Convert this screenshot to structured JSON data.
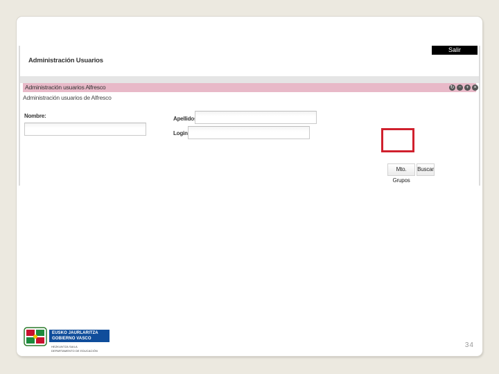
{
  "app": {
    "title": "Administración Usuarios",
    "exit_label": "Salir"
  },
  "panel": {
    "header_title": "Administración usuarios Alfresco",
    "subtitle": "Administración usuarios de Alfresco",
    "controls": [
      "refresh-icon",
      "minimize-icon",
      "maximize-icon",
      "close-icon"
    ]
  },
  "form": {
    "nombre_label": "Nombre:",
    "nombre_value": "",
    "apellidos_label": "Apellidos:",
    "apellidos_value": "",
    "login_label": "Login:",
    "login_value": ""
  },
  "buttons": {
    "groups_label": "Mto. Grupos",
    "search_label": "Buscar"
  },
  "colors": {
    "highlight": "#d0202d",
    "panel_header": "#e8b9c8",
    "logo_blue": "#0f4d9b"
  },
  "logo": {
    "line1": "EUSKO JAURLARITZA",
    "line2": "GOBIERNO VASCO",
    "dept1": "HEZKUNTZA SAILA",
    "dept2": "DEPARTAMENTO DE EDUCACIÓN"
  },
  "page_number": "34"
}
